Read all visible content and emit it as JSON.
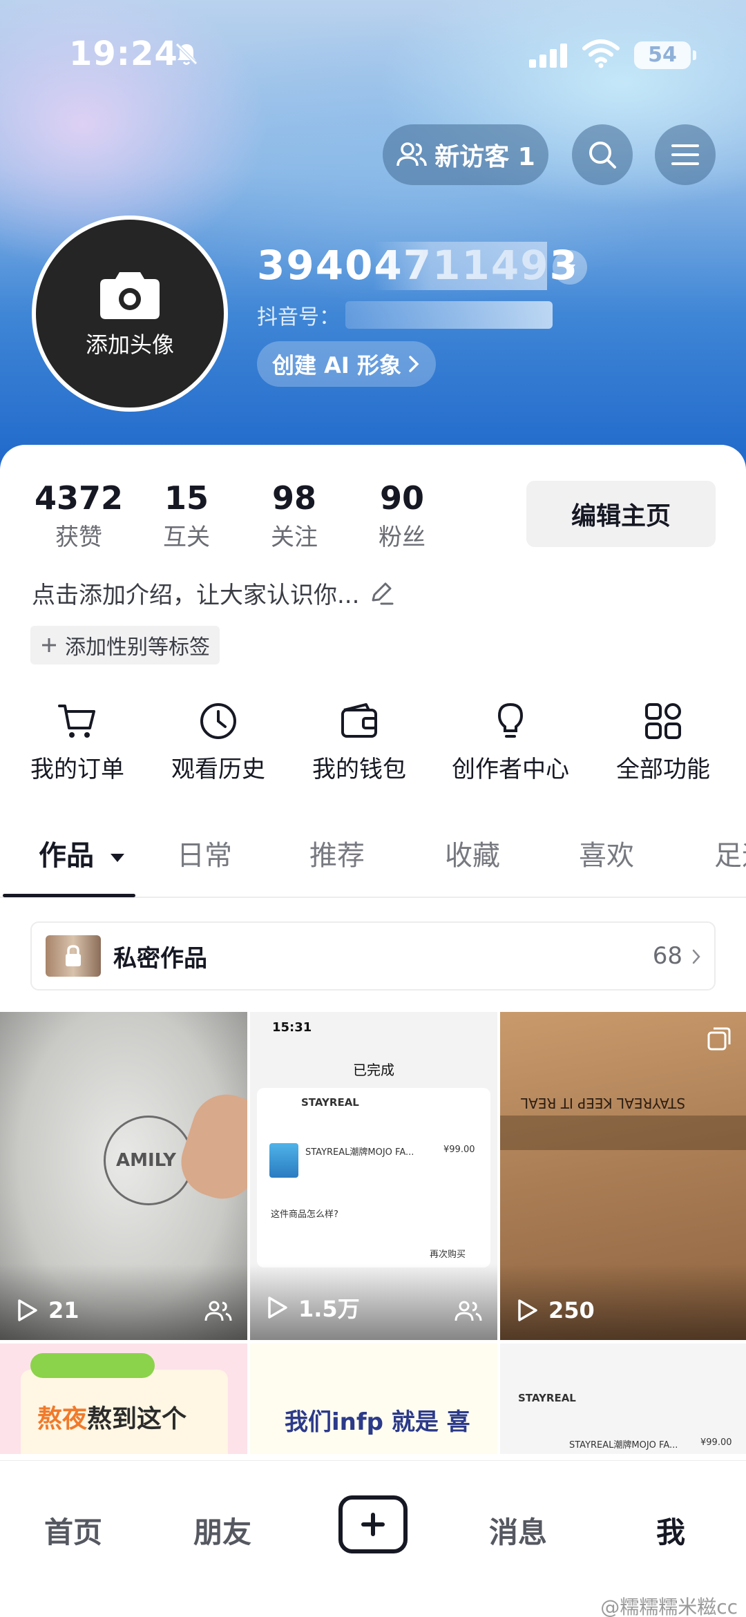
{
  "status_bar": {
    "time": "19:24",
    "battery": "54"
  },
  "header": {
    "visitor_label": "新访客 1",
    "avatar_label": "添加头像",
    "username": "39404711493",
    "douyin_id_label": "抖音号：",
    "ai_button_label": "创建 AI 形象"
  },
  "stats": [
    {
      "num": "4372",
      "label": "获赞"
    },
    {
      "num": "15",
      "label": "互关"
    },
    {
      "num": "98",
      "label": "关注"
    },
    {
      "num": "90",
      "label": "粉丝"
    }
  ],
  "edit_button": "编辑主页",
  "bio": "点击添加介绍，让大家认识你...",
  "tag_button": "添加性别等标签",
  "shortcuts": [
    {
      "label": "我的订单",
      "icon": "cart-icon"
    },
    {
      "label": "观看历史",
      "icon": "clock-icon"
    },
    {
      "label": "我的钱包",
      "icon": "wallet-icon"
    },
    {
      "label": "创作者中心",
      "icon": "bulb-icon"
    },
    {
      "label": "全部功能",
      "icon": "grid-icon"
    }
  ],
  "tabs": [
    "作品",
    "日常",
    "推荐",
    "收藏",
    "喜欢",
    "足迹"
  ],
  "private_works": {
    "label": "私密作品",
    "count": "68"
  },
  "videos": [
    {
      "plays": "21",
      "bag_text": "AMILY"
    },
    {
      "plays": "1.5万",
      "screenshot": {
        "time": "15:31",
        "title": "已完成",
        "store": "STAYREAL",
        "product": "STAYREAL潮牌MOJO FA...",
        "price": "¥99.00",
        "question": "这件商品怎么样?",
        "rebuy": "再次购买"
      }
    },
    {
      "plays": "250",
      "box_text": "STAYREAL  KEEP IT REAL"
    }
  ],
  "row2": {
    "c4_hl": "熬夜",
    "c4_rest": "熬到这个",
    "c5_text": "我们infp 就是 喜",
    "c6_store": "STAYREAL",
    "c6_product": "STAYREAL潮牌MOJO FA...",
    "c6_price": "¥99.00"
  },
  "bottom_nav": {
    "home": "首页",
    "friends": "朋友",
    "messages": "消息",
    "me": "我"
  },
  "watermark": "@糯糯糯米糍cc"
}
